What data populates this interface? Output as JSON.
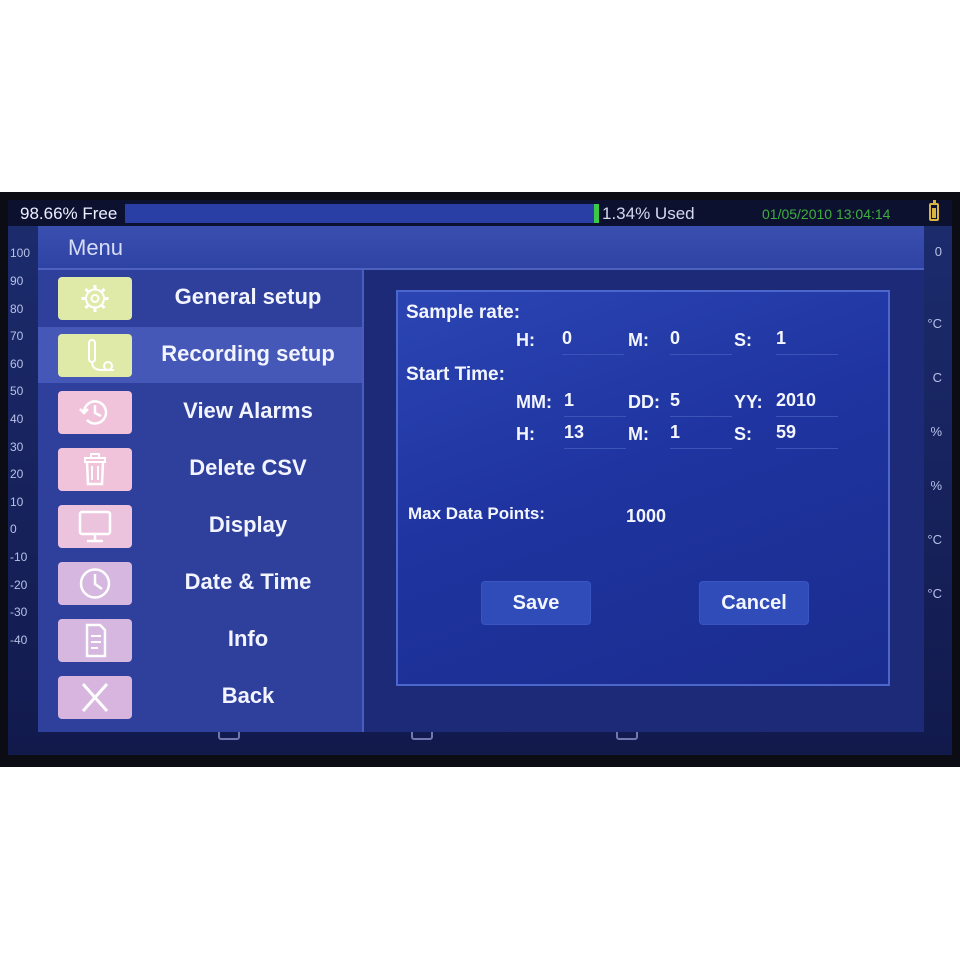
{
  "status_bar": {
    "free_text": "98.66% Free",
    "used_text": "1.34% Used",
    "used_fraction": 0.0134,
    "datetime": "01/05/2010 13:04:14",
    "datetime_color": "#3fae3f",
    "battery_icon": "battery-icon"
  },
  "background_chart": {
    "y_ticks": [
      "100",
      "90",
      "80",
      "70",
      "60",
      "50",
      "40",
      "30",
      "20",
      "10",
      "0",
      "-10",
      "-20",
      "-30",
      "-40"
    ],
    "unit_labels": [
      "0",
      "°C",
      "C",
      "%",
      "%",
      "°C",
      "°C"
    ]
  },
  "menu": {
    "title": "Menu",
    "items": [
      {
        "label": "General setup",
        "icon": "gear-icon",
        "icon_color": "#dfe9a8"
      },
      {
        "label": "Recording setup",
        "icon": "probe-icon",
        "icon_color": "#dfe9a8"
      },
      {
        "label": "View Alarms",
        "icon": "alarm-history-icon",
        "icon_color": "#f1c3da"
      },
      {
        "label": "Delete CSV",
        "icon": "trash-icon",
        "icon_color": "#f1c3da"
      },
      {
        "label": "Display",
        "icon": "monitor-icon",
        "icon_color": "#ecc3dd"
      },
      {
        "label": "Date & Time",
        "icon": "clock-icon",
        "icon_color": "#d6b7df"
      },
      {
        "label": "Info",
        "icon": "document-icon",
        "icon_color": "#d6b7df"
      },
      {
        "label": "Back",
        "icon": "close-icon",
        "icon_color": "#d7b5df"
      }
    ],
    "active_index": 1
  },
  "recording_setup": {
    "sample_rate_label": "Sample rate:",
    "sample_rate": {
      "h_label": "H:",
      "h_value": "0",
      "m_label": "M:",
      "m_value": "0",
      "s_label": "S:",
      "s_value": "1"
    },
    "start_time_label": "Start Time:",
    "start_date": {
      "mm_label": "MM:",
      "mm_value": "1",
      "dd_label": "DD:",
      "dd_value": "5",
      "yy_label": "YY:",
      "yy_value": "2010"
    },
    "start_clock": {
      "h_label": "H:",
      "h_value": "13",
      "m_label": "M:",
      "m_value": "1",
      "s_label": "S:",
      "s_value": "59"
    },
    "max_points_label": "Max Data Points:",
    "max_points_value": "1000",
    "save_label": "Save",
    "cancel_label": "Cancel"
  }
}
